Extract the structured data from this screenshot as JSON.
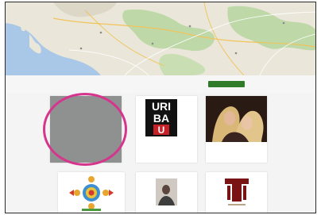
{
  "filters": {
    "first_label": "",
    "second_label": "",
    "button_label": ""
  },
  "cards": [
    {
      "title": "",
      "subtitle": ""
    },
    {
      "title": "",
      "subtitle": ""
    },
    {
      "title": "",
      "subtitle": ""
    },
    {
      "title": "",
      "subtitle": ""
    },
    {
      "title": "",
      "subtitle": ""
    },
    {
      "title": "",
      "subtitle": ""
    }
  ],
  "logo_text": [
    "URI",
    "BA",
    "U"
  ],
  "colors": {
    "map_water": "#a9c7e6",
    "map_land": "#eae7da",
    "map_forest": "#bfd8a8",
    "button_green": "#2f7b2a",
    "highlight_ring": "#d6358e",
    "placeholder_gray": "#8f9190"
  }
}
